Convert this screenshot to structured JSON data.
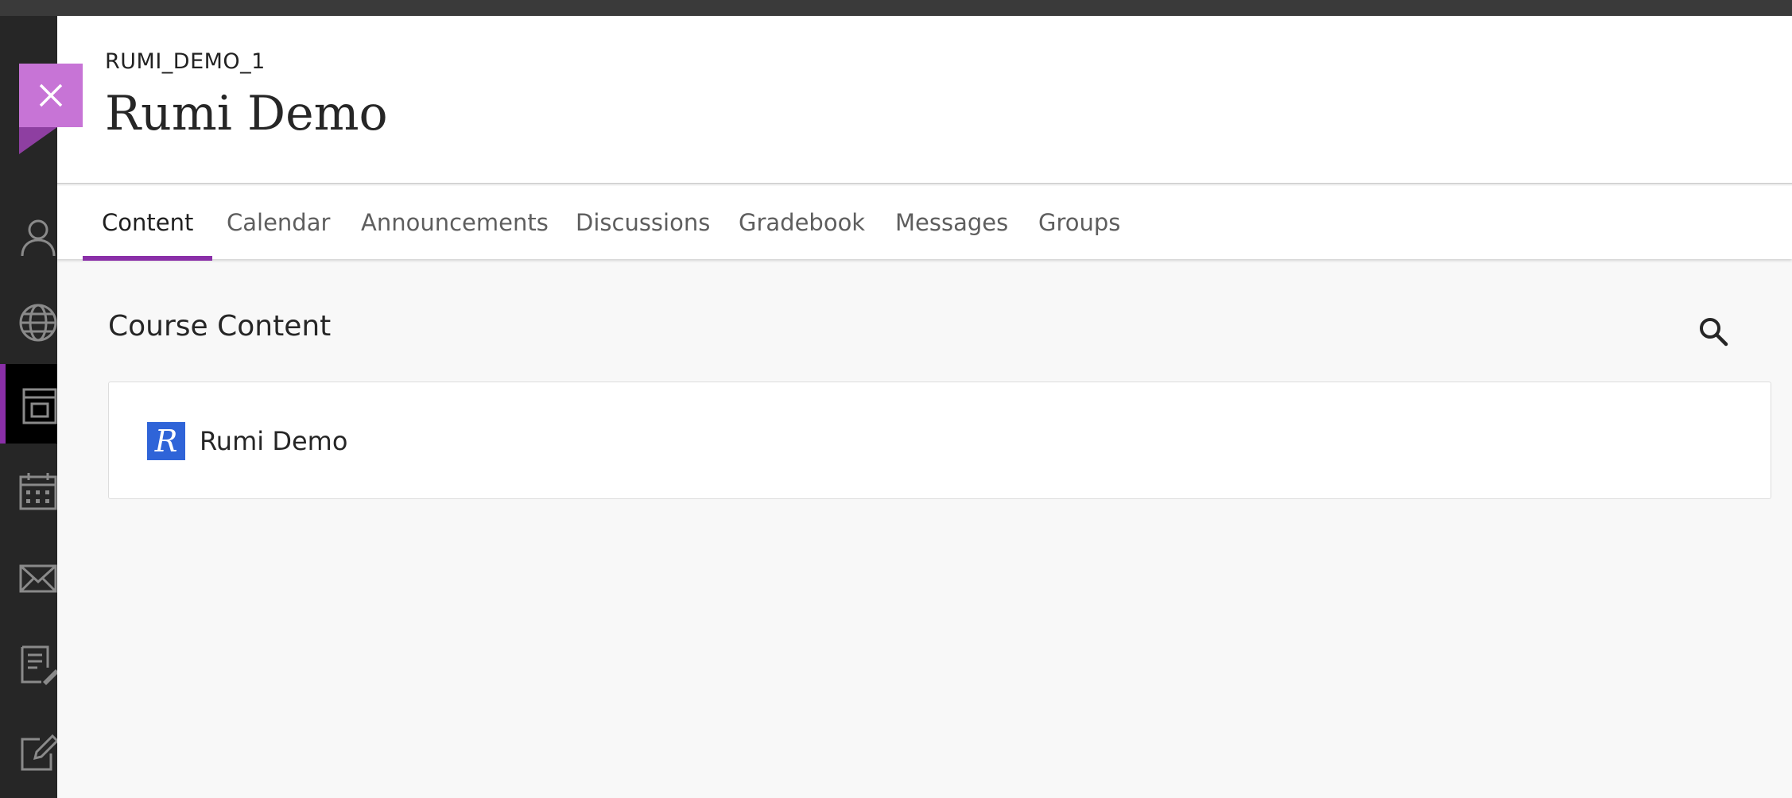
{
  "course": {
    "code": "RUMI_DEMO_1",
    "title": "Rumi Demo"
  },
  "tabs": [
    {
      "label": "Content",
      "active": true
    },
    {
      "label": "Calendar",
      "active": false
    },
    {
      "label": "Announcements",
      "active": false
    },
    {
      "label": "Discussions",
      "active": false
    },
    {
      "label": "Gradebook",
      "active": false
    },
    {
      "label": "Messages",
      "active": false
    },
    {
      "label": "Groups",
      "active": false
    }
  ],
  "content": {
    "section_title": "Course Content",
    "items": [
      {
        "title": "Rumi Demo",
        "logo_letter": "R",
        "icon": "rumi-logo"
      }
    ]
  },
  "leftnav": {
    "items": [
      {
        "icon": "profile-icon"
      },
      {
        "icon": "globe-icon"
      },
      {
        "icon": "courses-icon",
        "active": true
      },
      {
        "icon": "calendar-icon"
      },
      {
        "icon": "messages-icon"
      },
      {
        "icon": "grades-icon"
      },
      {
        "icon": "edit-icon"
      }
    ]
  },
  "colors": {
    "accent": "#8a2fa8",
    "close_tab": "#c774d6",
    "logo_bg": "#2f64d8",
    "nav_bg": "#262626"
  }
}
